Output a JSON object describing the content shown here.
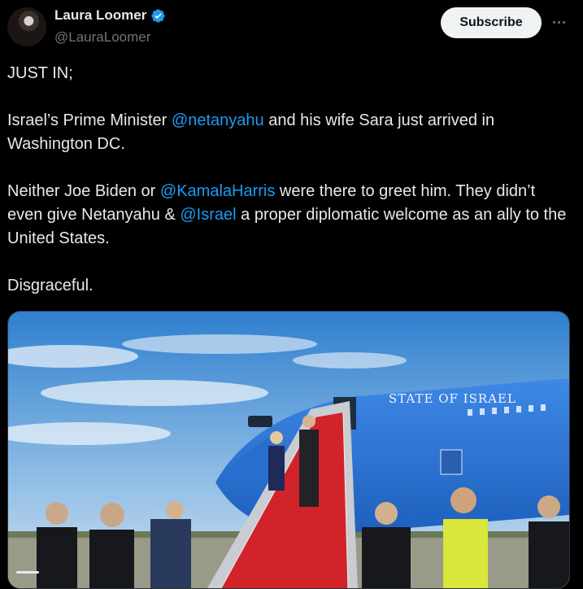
{
  "author": {
    "name": "Laura Loomer",
    "handle": "@LauraLoomer",
    "verified_icon": "verified-badge-icon",
    "avatar_icon": "avatar"
  },
  "actions": {
    "subscribe_label": "Subscribe",
    "more_icon": "more-horizontal-icon"
  },
  "tweet": {
    "line1": "JUST IN;",
    "p2_a": "Israel’s Prime Minister ",
    "p2_mention": "@netanyahu",
    "p2_b": " and his wife Sara just arrived in Washington DC.",
    "p3_a": "Neither Joe Biden or ",
    "p3_mention1": "@KamalaHarris",
    "p3_b": " were there to greet him. They didn’t even give Netanyahu & ",
    "p3_mention2": "@Israel",
    "p3_c": " a proper diplomatic welcome as an ally to the United States.",
    "p4": "Disgraceful."
  },
  "media": {
    "plane_text": "STATE OF ISRAEL",
    "video_progress": 0.04
  },
  "colors": {
    "background": "#000000",
    "text": "#e7e9ea",
    "secondary": "#71767b",
    "link": "#1d9bf0",
    "verified": "#1d9bf0"
  }
}
